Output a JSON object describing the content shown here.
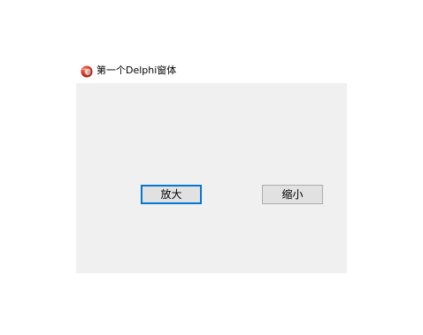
{
  "window": {
    "title": "第一个Delphi窗体",
    "icon": "delphi-app-icon"
  },
  "buttons": {
    "enlarge_label": "放大",
    "shrink_label": "缩小"
  },
  "colors": {
    "client_background": "#f0f0f0",
    "button_face": "#e1e1e1",
    "button_border": "#adadad",
    "focus_border": "#0078d7",
    "icon_red": "#d9352b"
  }
}
